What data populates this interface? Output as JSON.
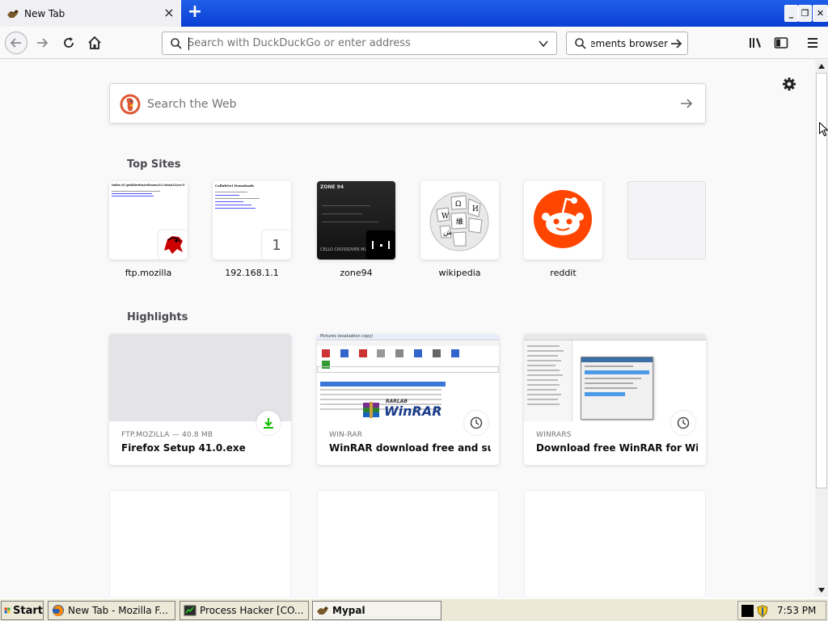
{
  "browser": {
    "tab": {
      "title": "New Tab",
      "close_icon": "×"
    },
    "new_tab_icon": "+",
    "window_buttons": {
      "minimize": "_",
      "maximize": "❐",
      "close": "✕"
    },
    "urlbar": {
      "placeholder": "Search with DuckDuckGo or enter address"
    },
    "searchbar": {
      "value": "ements browser"
    }
  },
  "newtab": {
    "websearch": {
      "placeholder": "Search the Web"
    },
    "top_sites_title": "Top Sites",
    "top_sites": [
      {
        "label": "ftp.mozilla"
      },
      {
        "label": "192.168.1.1",
        "badge": "1"
      },
      {
        "label": "zone94"
      },
      {
        "label": "wikipedia"
      },
      {
        "label": "reddit"
      },
      {
        "label": ""
      }
    ],
    "highlights_title": "Highlights",
    "highlights": [
      {
        "context": "FTP.MOZILLA — 40.8 MB",
        "title": "Firefox Setup 41.0.exe",
        "badge_icon": "download-icon"
      },
      {
        "context": "WIN-RAR",
        "title": "WinRAR download free and sup...",
        "badge_icon": "clock-icon"
      },
      {
        "context": "WINRARS",
        "title": "Download free WinRAR for Win...",
        "badge_icon": "clock-icon"
      }
    ],
    "thumb_text": {
      "ftp_heading": "Index of /pub/firefox/releases/41.0/win32/en-US/",
      "router_heading": "CollabNet Downloads",
      "zone_heading": "ZONE 94",
      "zone_sub": "CELLO CROSSOVER MUSIC",
      "winrar_window": "Pictures (evaluation copy)",
      "winrar_logo": "WinRAR",
      "winrar_brand": "RARLAB"
    }
  },
  "taskbar": {
    "start_label": "Start",
    "tasks": [
      {
        "label": "New Tab - Mozilla F..."
      },
      {
        "label": "Process Hacker [CO..."
      },
      {
        "label": "Mypal"
      }
    ],
    "clock": "7:53 PM"
  },
  "colors": {
    "titlebar_blue": "#0a3fd3",
    "reddit_orange": "#ff4500",
    "ddg_orange": "#de5833",
    "download_green": "#12bc00"
  }
}
